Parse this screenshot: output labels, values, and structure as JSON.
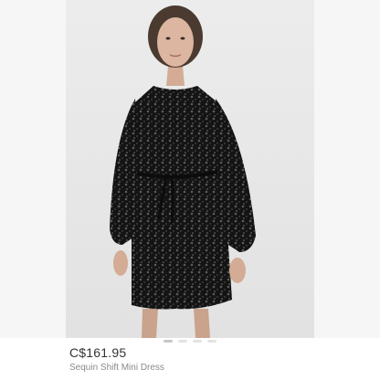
{
  "product": {
    "price": "C$161.95",
    "name": "Sequin Shift Mini Dress",
    "image_description_icon": "product-photo-icon"
  },
  "carousel": {
    "count": 4,
    "active_index": 0
  },
  "colors": {
    "background": "#ffffff",
    "photo_backdrop": "#e8e8e8",
    "dress": "#151515",
    "price_text": "#333333",
    "name_text": "#8a8a8a"
  }
}
